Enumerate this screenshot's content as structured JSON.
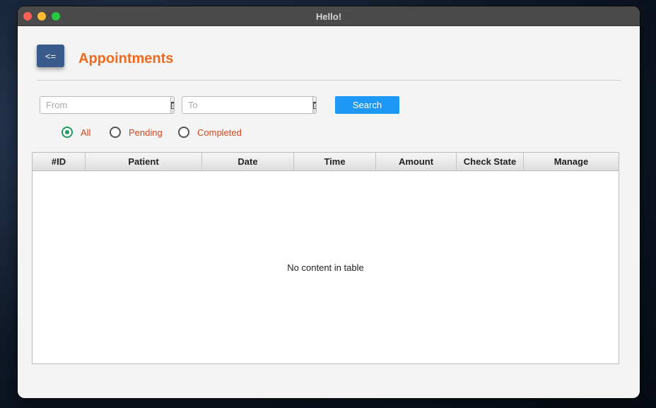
{
  "window": {
    "title": "Hello!"
  },
  "header": {
    "back_label": "<=",
    "title": "Appointments"
  },
  "filters": {
    "from_placeholder": "From",
    "to_placeholder": "To",
    "search_label": "Search",
    "radios": [
      {
        "label": "All",
        "selected": true
      },
      {
        "label": "Pending",
        "selected": false
      },
      {
        "label": "Completed",
        "selected": false
      }
    ]
  },
  "table": {
    "columns": [
      "#ID",
      "Patient",
      "Date",
      "Time",
      "Amount",
      "Check State",
      "Manage"
    ],
    "rows": [],
    "empty_message": "No content in table"
  },
  "colors": {
    "accent_title": "#f26a1b",
    "back_button": "#3b5a8c",
    "search_button": "#1e98f5",
    "radio_selected": "#1e9c5e",
    "radio_label": "#d4471f"
  },
  "icons": [
    "calendar-icon"
  ]
}
